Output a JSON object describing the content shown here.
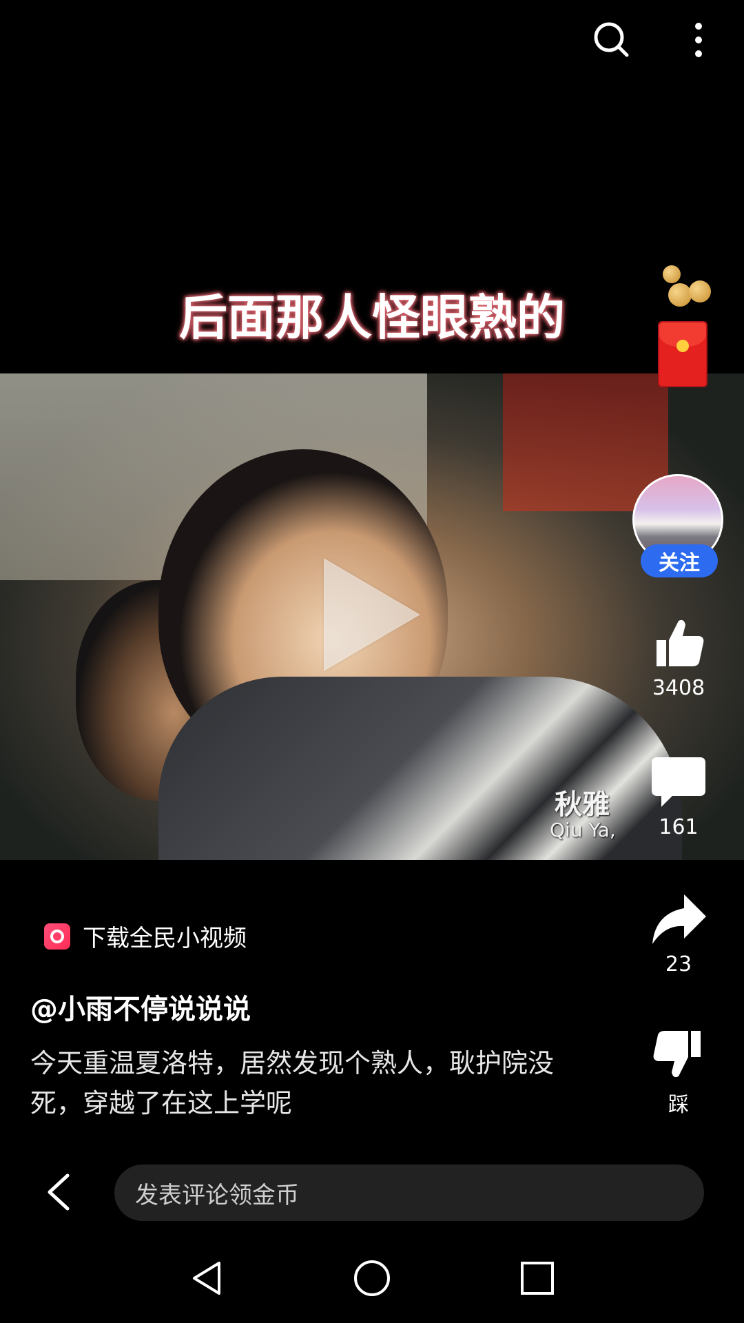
{
  "top_bar": {
    "search_icon": "search-icon",
    "more_icon": "more-vertical-icon"
  },
  "video": {
    "caption": "后面那人怪眼熟的",
    "subtitle_cn": "秋雅",
    "subtitle_en": "Qiu Ya,",
    "play_icon": "play-icon"
  },
  "sidebar": {
    "follow_label": "关注",
    "like_count": "3408",
    "comment_count": "161",
    "share_count": "23",
    "dislike_label": "踩"
  },
  "post": {
    "download_label": "下载全民小视频",
    "username": "@小雨不停说说说",
    "description": "今天重温夏洛特，居然发现个熟人，耿护院没死，穿越了在这上学呢"
  },
  "comment_bar": {
    "placeholder": "发表评论领金币"
  },
  "colors": {
    "follow_button": "#2d6cf0",
    "caption_glow": "#d9626c",
    "red_packet": "#e4211f"
  }
}
